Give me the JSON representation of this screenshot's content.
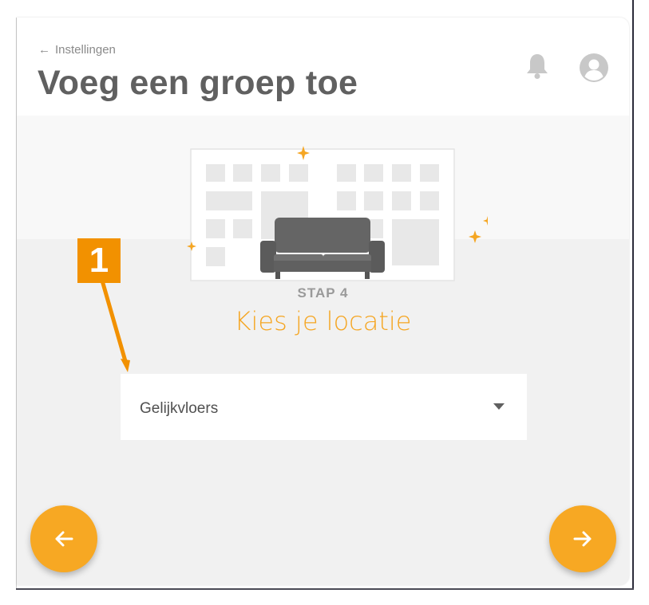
{
  "header": {
    "back_label": "Instellingen",
    "title": "Voeg een groep toe"
  },
  "icons": {
    "bell": "bell-icon",
    "avatar": "user-circle-icon",
    "back_arrow": "arrow-left-icon",
    "dropdown": "caret-down-icon",
    "sparkle": "sparkle-icon",
    "sofa": "sofa-icon"
  },
  "wizard": {
    "step_label": "STAP 4",
    "step_title": "Kies je locatie",
    "location_select": {
      "selected": "Gelijkvloers"
    }
  },
  "annotation": {
    "number": "1"
  },
  "colors": {
    "accent": "#f7a823",
    "annotation": "#f29100",
    "title_text": "#606060",
    "background": "#f1f1f1"
  }
}
